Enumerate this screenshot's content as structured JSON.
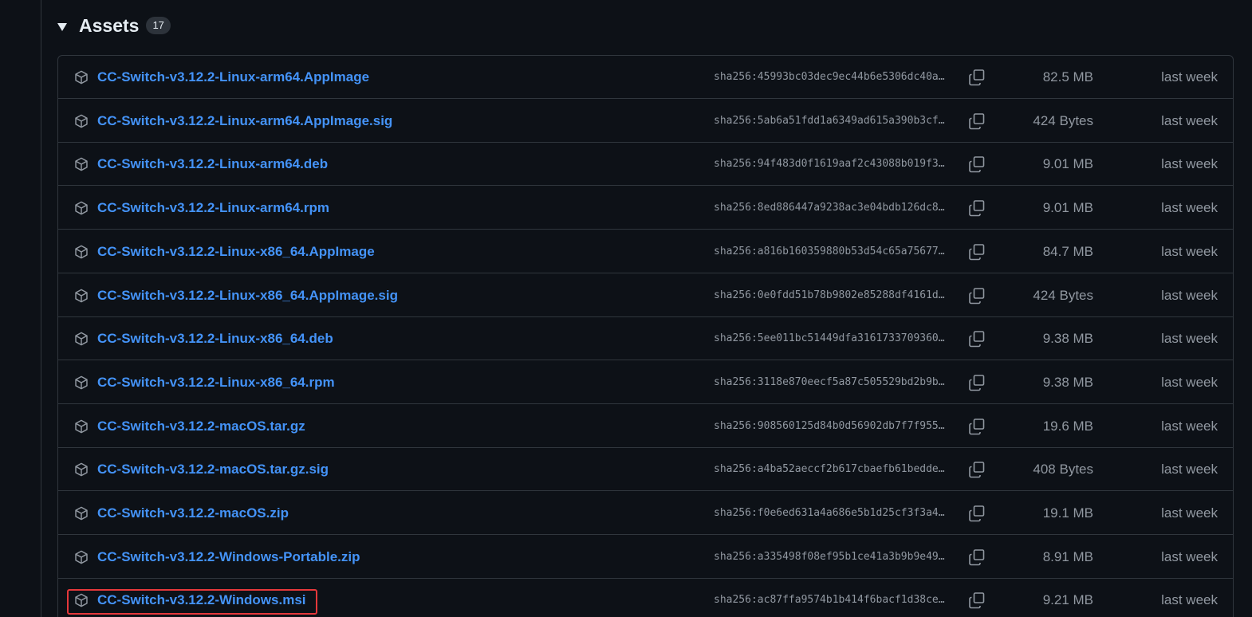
{
  "section": {
    "title": "Assets",
    "count": "17"
  },
  "colors": {
    "background": "#0d1117",
    "border": "#30363d",
    "link": "#4493f8",
    "muted": "#9198a1",
    "highlight": "#e5383b"
  },
  "icons": {
    "toggle": "triangle-down-icon",
    "asset": "package-icon",
    "copy": "copy-icon"
  },
  "assets": [
    {
      "name": "CC-Switch-v3.12.2-Linux-arm64.AppImage",
      "digest": "sha256:45993bc03dec9ec44b6e5306dc40a…",
      "size": "82.5 MB",
      "date": "last week"
    },
    {
      "name": "CC-Switch-v3.12.2-Linux-arm64.AppImage.sig",
      "digest": "sha256:5ab6a51fdd1a6349ad615a390b3cf…",
      "size": "424 Bytes",
      "date": "last week"
    },
    {
      "name": "CC-Switch-v3.12.2-Linux-arm64.deb",
      "digest": "sha256:94f483d0f1619aaf2c43088b019f3…",
      "size": "9.01 MB",
      "date": "last week"
    },
    {
      "name": "CC-Switch-v3.12.2-Linux-arm64.rpm",
      "digest": "sha256:8ed886447a9238ac3e04bdb126dc8…",
      "size": "9.01 MB",
      "date": "last week"
    },
    {
      "name": "CC-Switch-v3.12.2-Linux-x86_64.AppImage",
      "digest": "sha256:a816b160359880b53d54c65a75677…",
      "size": "84.7 MB",
      "date": "last week"
    },
    {
      "name": "CC-Switch-v3.12.2-Linux-x86_64.AppImage.sig",
      "digest": "sha256:0e0fdd51b78b9802e85288df4161d…",
      "size": "424 Bytes",
      "date": "last week"
    },
    {
      "name": "CC-Switch-v3.12.2-Linux-x86_64.deb",
      "digest": "sha256:5ee011bc51449dfa3161733709360…",
      "size": "9.38 MB",
      "date": "last week"
    },
    {
      "name": "CC-Switch-v3.12.2-Linux-x86_64.rpm",
      "digest": "sha256:3118e870eecf5a87c505529bd2b9b…",
      "size": "9.38 MB",
      "date": "last week"
    },
    {
      "name": "CC-Switch-v3.12.2-macOS.tar.gz",
      "digest": "sha256:908560125d84b0d56902db7f7f955…",
      "size": "19.6 MB",
      "date": "last week"
    },
    {
      "name": "CC-Switch-v3.12.2-macOS.tar.gz.sig",
      "digest": "sha256:a4ba52aeccf2b617cbaefb61bedde…",
      "size": "408 Bytes",
      "date": "last week"
    },
    {
      "name": "CC-Switch-v3.12.2-macOS.zip",
      "digest": "sha256:f0e6ed631a4a686e5b1d25cf3f3a4…",
      "size": "19.1 MB",
      "date": "last week"
    },
    {
      "name": "CC-Switch-v3.12.2-Windows-Portable.zip",
      "digest": "sha256:a335498f08ef95b1ce41a3b9b9e49…",
      "size": "8.91 MB",
      "date": "last week"
    },
    {
      "name": "CC-Switch-v3.12.2-Windows.msi",
      "digest": "sha256:ac87ffa9574b1b414f6bacf1d38ce…",
      "size": "9.21 MB",
      "date": "last week",
      "highlighted": true
    }
  ]
}
